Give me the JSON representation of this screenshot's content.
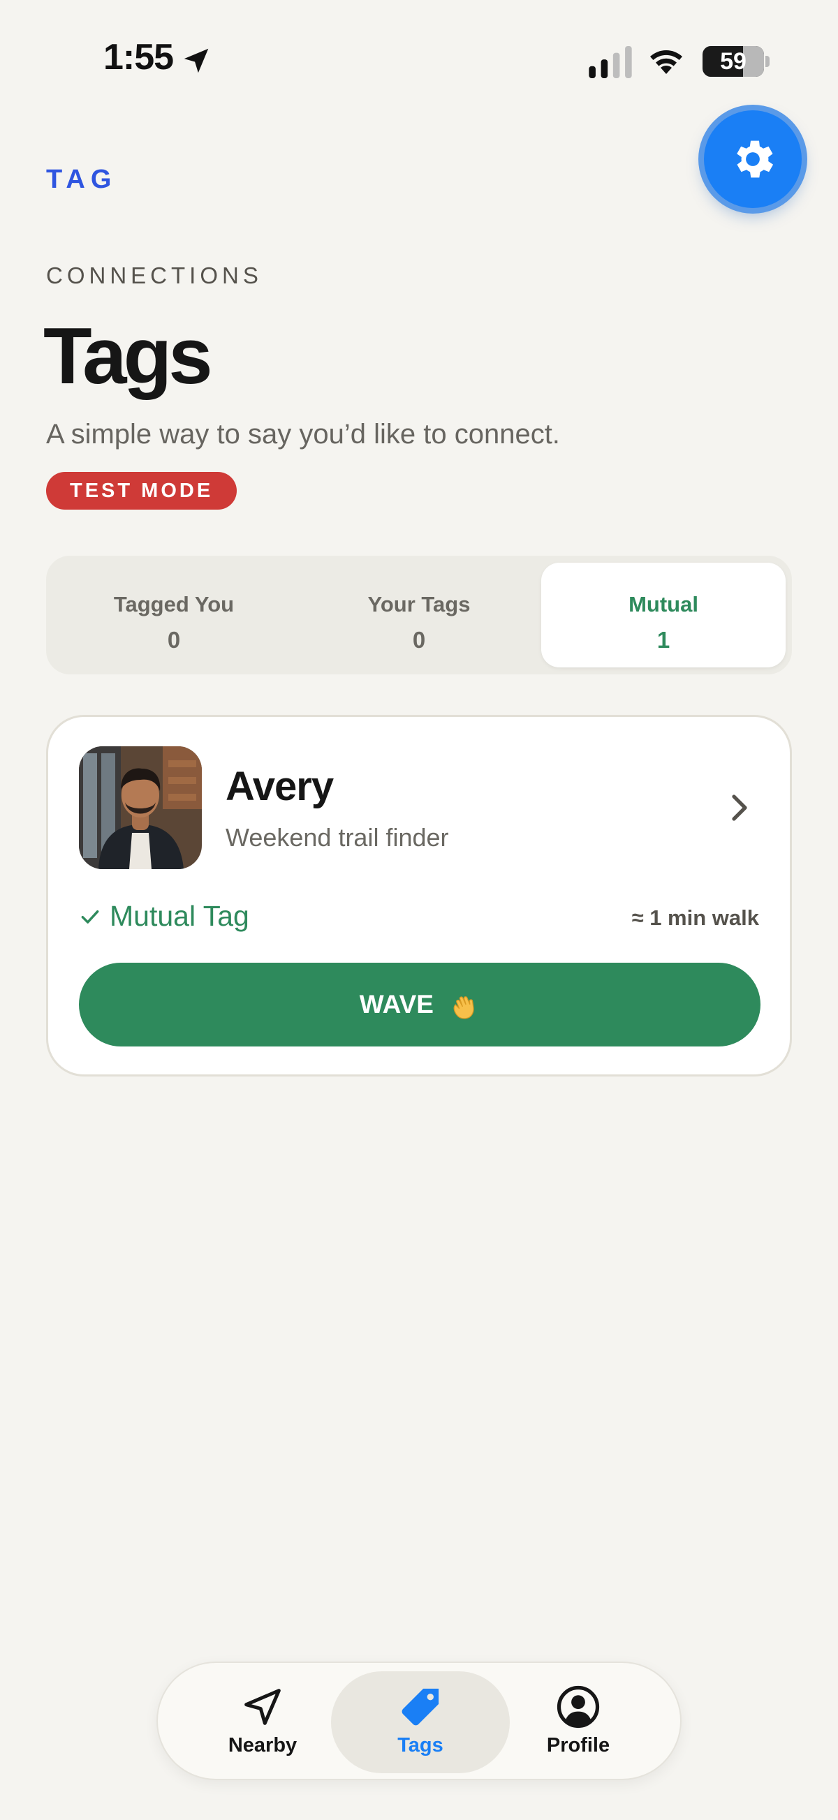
{
  "status_bar": {
    "time": "1:55",
    "battery": "59"
  },
  "header": {
    "brand": "TAG",
    "settings_icon": "gear-icon",
    "eyebrow": "CONNECTIONS",
    "title": "Tags",
    "subtitle": "A simple way to say you’d like to connect.",
    "badge": "TEST MODE"
  },
  "segments": [
    {
      "label": "Tagged You",
      "count": "0",
      "active": false
    },
    {
      "label": "Your Tags",
      "count": "0",
      "active": false
    },
    {
      "label": "Mutual",
      "count": "1",
      "active": true
    }
  ],
  "card": {
    "name": "Avery",
    "tagline": "Weekend trail finder",
    "status": "Mutual Tag",
    "distance": "≈ 1 min walk",
    "action": "WAVE"
  },
  "tabbar": {
    "items": [
      {
        "label": "Nearby",
        "icon": "navigation-arrow-icon",
        "active": false
      },
      {
        "label": "Tags",
        "icon": "tag-icon",
        "active": true
      },
      {
        "label": "Profile",
        "icon": "person-circle-icon",
        "active": false
      }
    ]
  },
  "colors": {
    "background": "#f5f4f0",
    "brand": "#2f55e0",
    "accent_green": "#2e8a5c",
    "badge_red": "#cf3a37",
    "tab_active": "#1a7ff5"
  }
}
